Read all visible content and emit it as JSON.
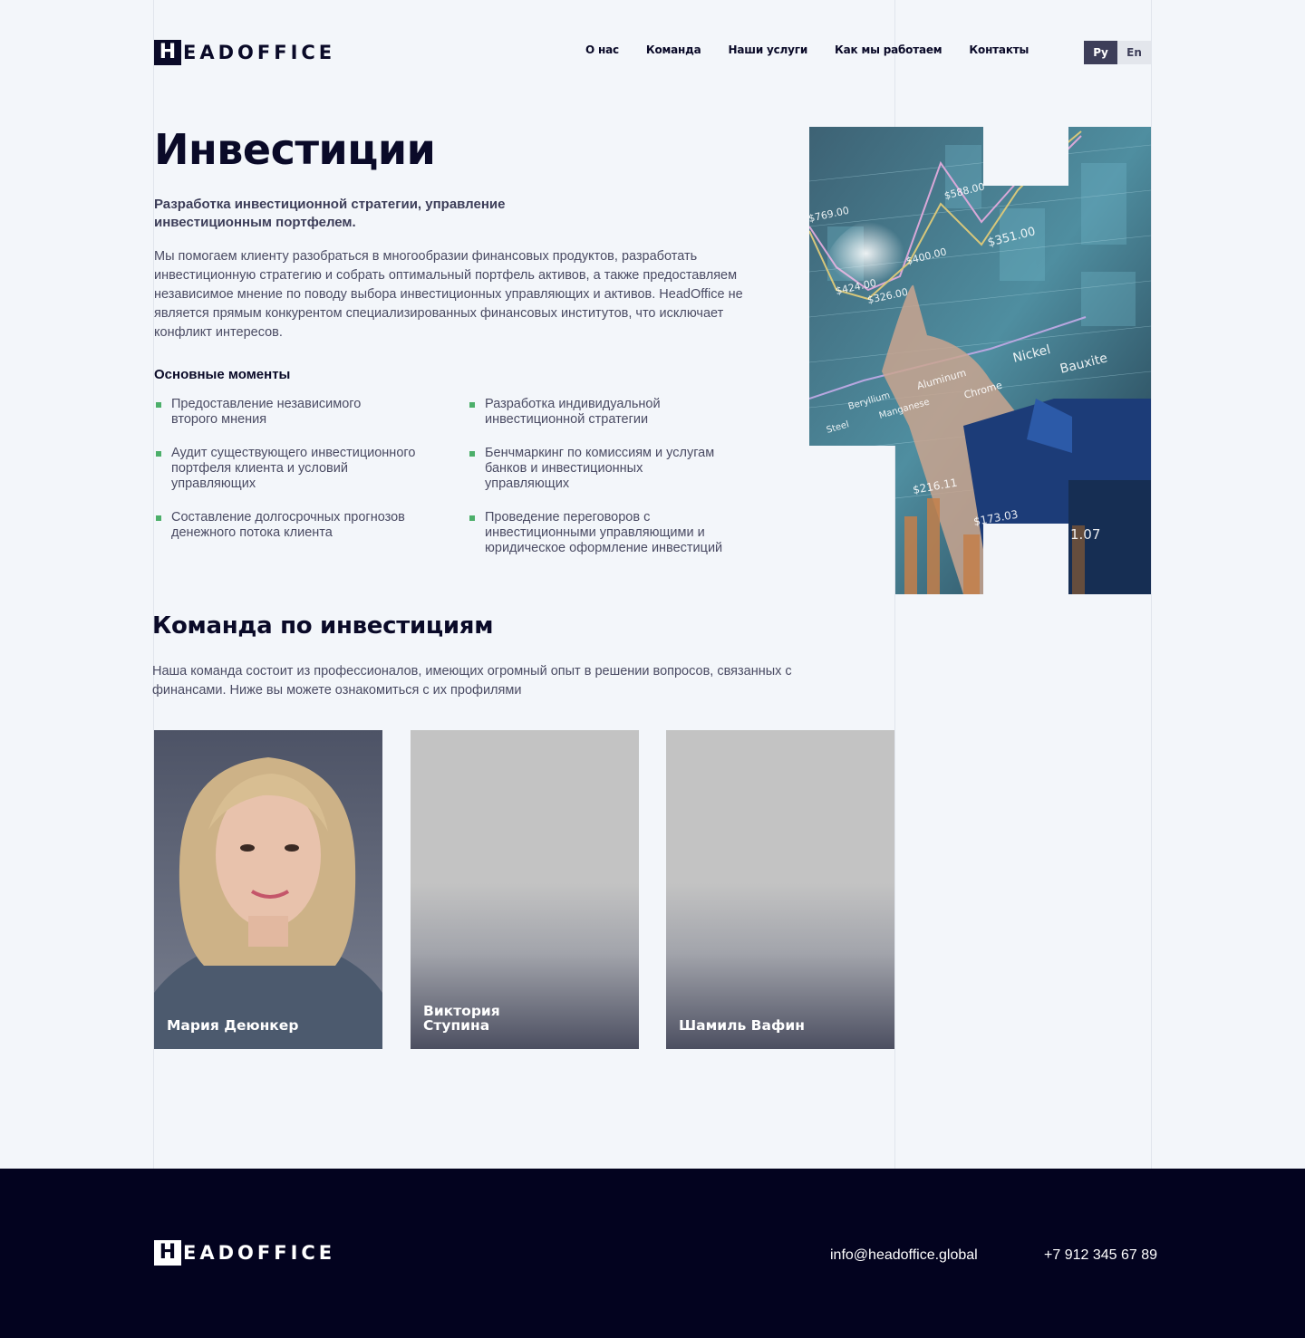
{
  "brand": {
    "mark": "H",
    "word": "EADOFFICE"
  },
  "nav": {
    "items": [
      "О нас",
      "Команда",
      "Наши услуги",
      "Как мы работаем",
      "Контакты"
    ]
  },
  "lang": {
    "active": "Ру",
    "inactive": "En"
  },
  "hero": {
    "title": "Инвестиции",
    "lead": "Разработка инвестиционной стратегии, управление инвестиционным портфелем.",
    "body": "Мы помогаем клиенту разобраться в многообразии финансовых продуктов, разработать инвестиционную стратегию и собрать оптимальный портфель активов, а также предоставляем независимое мнение по поводу выбора инвестиционных управляющих и активов. HeadOffice не является прямым конкурентом специализированных финансовых институтов, что исключает конфликт интересов.",
    "points_title": "Основные моменты",
    "points": [
      "Предоставление независимого второго мнения",
      "Разработка индивидуальной инвестиционной стратегии",
      "Аудит существующего инвестиционного портфеля клиента и условий управляющих",
      "Бенчмаркинг по комиссиям и услугам банков и инвестиционных управляющих",
      "Составление долгосрочных прогнозов денежного потока клиента",
      "Проведение переговоров с инвестиционными управляющими и юридическое оформление инвестиций"
    ],
    "image_labels": [
      "$769.00",
      "$588.00",
      "$424.00",
      "$326.00",
      "$400.00",
      "$351.00",
      "$216.11",
      "$173.03",
      "1.07",
      "Nickel",
      "Bauxite",
      "Aluminum",
      "Chrome",
      "Beryllium",
      "Manganese",
      "Steel"
    ]
  },
  "team": {
    "title": "Команда по инвестициям",
    "description": "Наша команда состоит из профессионалов, имеющих огромный опыт в решении вопросов, связанных с финансами. Ниже вы можете ознакомиться с их профилями",
    "members": [
      {
        "name": "Мария Деюнкер"
      },
      {
        "name": "Виктория\nСтупина"
      },
      {
        "name": "Шамиль Вафин"
      }
    ]
  },
  "footer": {
    "email": "info@headoffice.global",
    "phone": "+7 912 345 67 89"
  },
  "colors": {
    "background": "#f3f6fa",
    "ink": "#0a0a28",
    "accent_bullet": "#4caf6a",
    "lang_active": "#3d3e59",
    "footer": "#03031f"
  }
}
